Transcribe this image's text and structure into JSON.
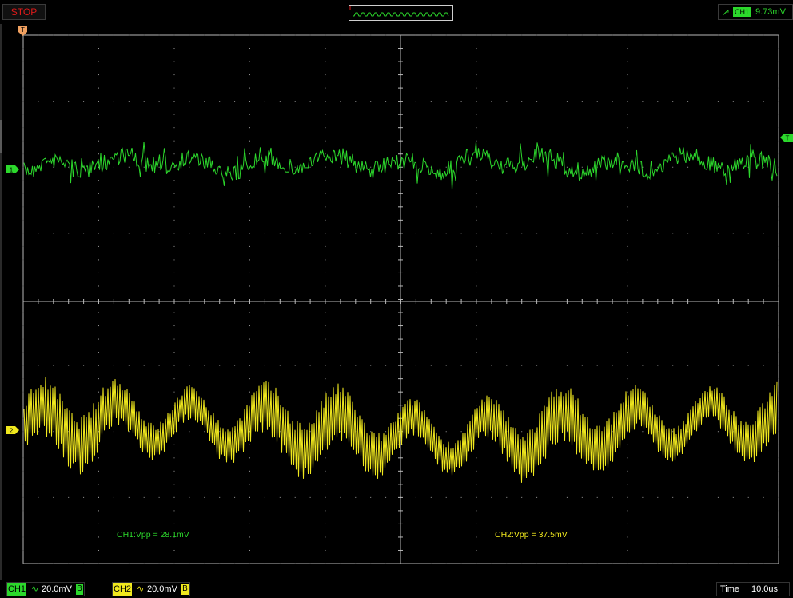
{
  "run_state": "STOP",
  "trigger": {
    "source": "CH1",
    "level": "9.73mV"
  },
  "channels": [
    {
      "label": "CH1",
      "coupling": "∿",
      "scale": "20.0mV",
      "bw": "B",
      "marker": "1",
      "color": "#2cd82c"
    },
    {
      "label": "CH2",
      "coupling": "∿",
      "scale": "20.0mV",
      "bw": "B",
      "marker": "2",
      "color": "#f0e81e"
    }
  ],
  "timebase": {
    "label": "Time",
    "value": "10.0us"
  },
  "markers": {
    "trigger_position": "T",
    "trigger_level": "T"
  },
  "measurements": {
    "ch1": "CH1:Vpp = 28.1mV",
    "ch2": "CH2:Vpp = 37.5mV"
  },
  "colors": {
    "grid": "#d0d0d0",
    "background": "#000000",
    "ch1": "#2cd82c",
    "ch2": "#f0e81e",
    "stop": "#e01a1a",
    "marker": "#f0a060"
  }
}
